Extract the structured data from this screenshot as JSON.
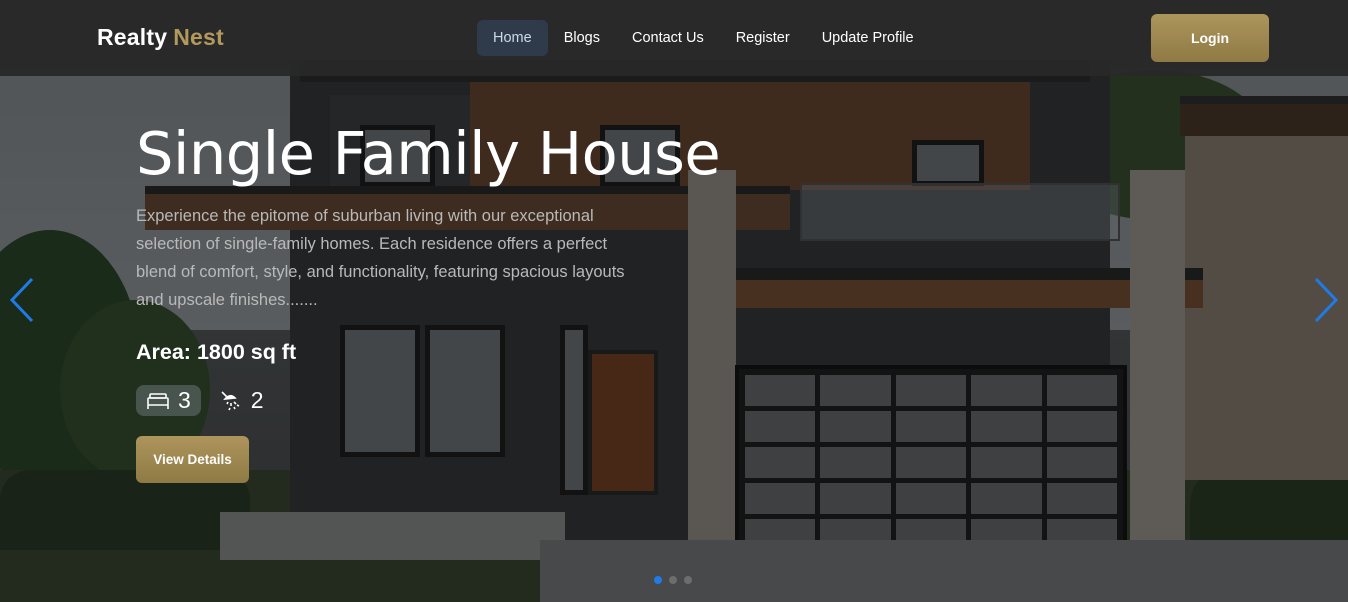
{
  "brand": {
    "part1": "Realty",
    "part2": "Nest"
  },
  "nav": {
    "links": [
      {
        "label": "Home",
        "active": true
      },
      {
        "label": "Blogs",
        "active": false
      },
      {
        "label": "Contact Us",
        "active": false
      },
      {
        "label": "Register",
        "active": false
      },
      {
        "label": "Update Profile",
        "active": false
      }
    ],
    "login_label": "Login"
  },
  "hero": {
    "title": "Single Family House",
    "description": "Experience the epitome of suburban living with our exceptional selection of single-family homes. Each residence offers a perfect blend of comfort, style, and functionality, featuring spacious layouts and upscale finishes.......",
    "area": "Area: 1800 sq ft",
    "bedrooms": "3",
    "bathrooms": "2",
    "cta_label": "View Details",
    "icons": {
      "bed": "bed-icon",
      "bath": "shower-icon",
      "prev": "chevron-left-icon",
      "next": "chevron-right-icon"
    }
  },
  "carousel": {
    "slide_count": 3,
    "active_index": 0
  },
  "colors": {
    "accent_gold": "#b39a5c",
    "nav_bg": "#282828",
    "active_link_bg": "#2f3a4a",
    "arrow_blue": "#1e7be8"
  }
}
